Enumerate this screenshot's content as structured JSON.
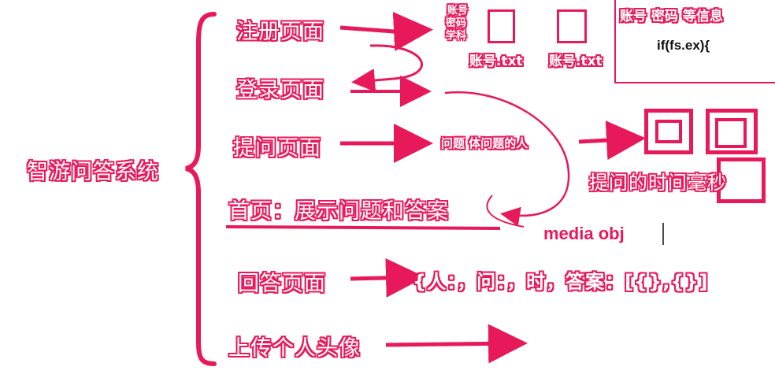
{
  "colors": {
    "accent": "#e8195a",
    "ink": "#111111"
  },
  "root": {
    "label": "智游问答系统"
  },
  "branches": [
    {
      "label": "注册页面"
    },
    {
      "label": "登录页面"
    },
    {
      "label": "提问页面"
    },
    {
      "label": "首页：展示问题和答案"
    },
    {
      "label": "回答页面"
    },
    {
      "label": "上传个人头像"
    }
  ],
  "register_fields": [
    "账号",
    "密码",
    "学科"
  ],
  "files": [
    "账号.txt",
    "账号.txt"
  ],
  "info_box": {
    "title": "账号 密码 等信息",
    "code": "if(fs.ex){"
  },
  "question_note": "问题 体问题的人",
  "timestamp_note": "提问的时间毫秒",
  "media_note": "media obj",
  "answer_structure": "{人：，问：，时，答案：[{},{}]"
}
